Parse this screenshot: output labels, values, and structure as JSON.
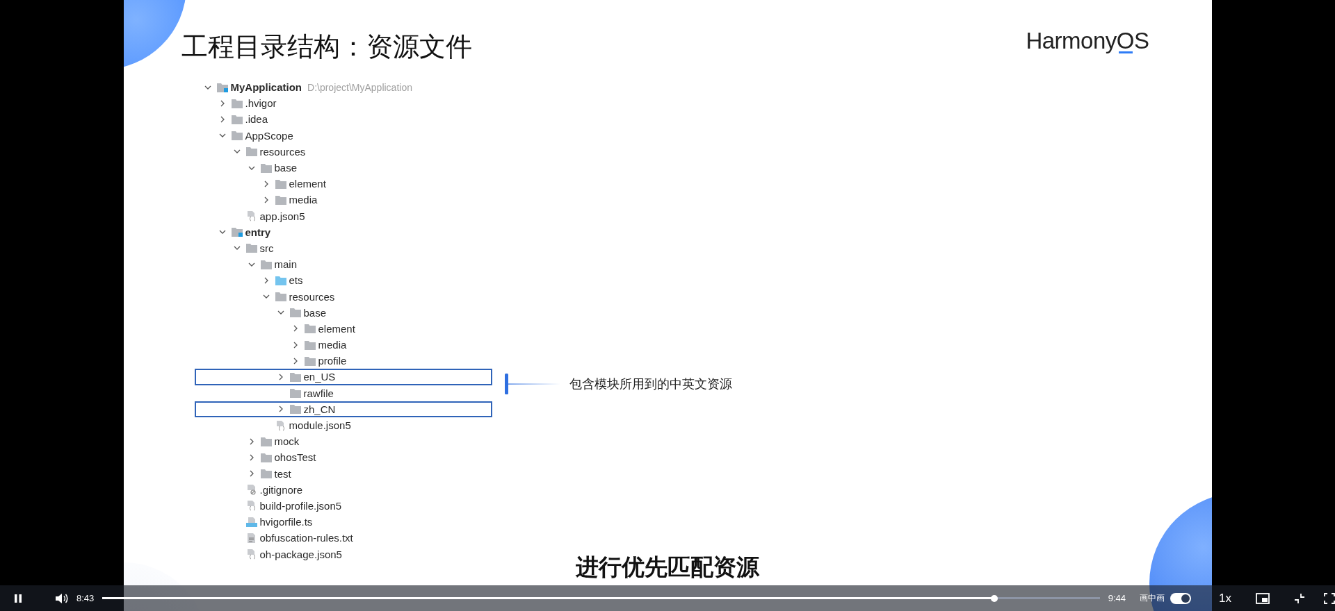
{
  "slide": {
    "title": "工程目录结构：资源文件",
    "logo": "HarmonyOS",
    "tree": [
      {
        "name": "MyApplication",
        "kind": "module",
        "detail": "D:\\project\\MyApplication",
        "expanded": true,
        "highlighted": false,
        "children": [
          {
            "name": ".hvigor",
            "kind": "folder",
            "expanded": false,
            "highlighted": false
          },
          {
            "name": ".idea",
            "kind": "folder",
            "expanded": false,
            "highlighted": false
          },
          {
            "name": "AppScope",
            "kind": "folder",
            "expanded": true,
            "highlighted": false,
            "children": [
              {
                "name": "resources",
                "kind": "folder",
                "expanded": true,
                "highlighted": false,
                "children": [
                  {
                    "name": "base",
                    "kind": "folder",
                    "expanded": true,
                    "highlighted": false,
                    "children": [
                      {
                        "name": "element",
                        "kind": "folder",
                        "expanded": false,
                        "highlighted": false
                      },
                      {
                        "name": "media",
                        "kind": "folder",
                        "expanded": false,
                        "highlighted": false
                      }
                    ]
                  }
                ]
              },
              {
                "name": "app.json5",
                "kind": "json",
                "highlighted": false
              }
            ]
          },
          {
            "name": "entry",
            "kind": "module",
            "expanded": true,
            "highlighted": false,
            "children": [
              {
                "name": "src",
                "kind": "folder",
                "expanded": true,
                "highlighted": false,
                "children": [
                  {
                    "name": "main",
                    "kind": "folder",
                    "expanded": true,
                    "highlighted": false,
                    "children": [
                      {
                        "name": "ets",
                        "kind": "source",
                        "expanded": false,
                        "highlighted": false
                      },
                      {
                        "name": "resources",
                        "kind": "folder",
                        "expanded": true,
                        "highlighted": false,
                        "children": [
                          {
                            "name": "base",
                            "kind": "folder",
                            "expanded": true,
                            "highlighted": false,
                            "children": [
                              {
                                "name": "element",
                                "kind": "folder",
                                "expanded": false,
                                "highlighted": false
                              },
                              {
                                "name": "media",
                                "kind": "folder",
                                "expanded": false,
                                "highlighted": false
                              },
                              {
                                "name": "profile",
                                "kind": "folder",
                                "expanded": false,
                                "highlighted": false
                              }
                            ]
                          },
                          {
                            "name": "en_US",
                            "kind": "folder",
                            "expanded": false,
                            "highlighted": true
                          },
                          {
                            "name": "rawfile",
                            "kind": "folder",
                            "highlighted": false
                          },
                          {
                            "name": "zh_CN",
                            "kind": "folder",
                            "expanded": false,
                            "highlighted": true
                          }
                        ]
                      },
                      {
                        "name": "module.json5",
                        "kind": "json",
                        "highlighted": false
                      }
                    ]
                  },
                  {
                    "name": "mock",
                    "kind": "folder",
                    "expanded": false,
                    "highlighted": false
                  },
                  {
                    "name": "ohosTest",
                    "kind": "folder",
                    "expanded": false,
                    "highlighted": false
                  },
                  {
                    "name": "test",
                    "kind": "folder",
                    "expanded": false,
                    "highlighted": false
                  }
                ]
              },
              {
                "name": ".gitignore",
                "kind": "ignore",
                "highlighted": false
              },
              {
                "name": "build-profile.json5",
                "kind": "json",
                "highlighted": false
              },
              {
                "name": "hvigorfile.ts",
                "kind": "ts",
                "highlighted": false
              },
              {
                "name": "obfuscation-rules.txt",
                "kind": "text",
                "highlighted": false
              },
              {
                "name": "oh-package.json5",
                "kind": "json",
                "highlighted": false
              }
            ]
          }
        ]
      }
    ],
    "callout": "包含模块所用到的中英文资源"
  },
  "subtitle": "进行优先匹配资源",
  "player": {
    "playing": true,
    "current_time": "8:43",
    "level": 0.894,
    "duration": "9:44",
    "pip_label": "画中画",
    "pip_on": true,
    "speed": "1x"
  }
}
